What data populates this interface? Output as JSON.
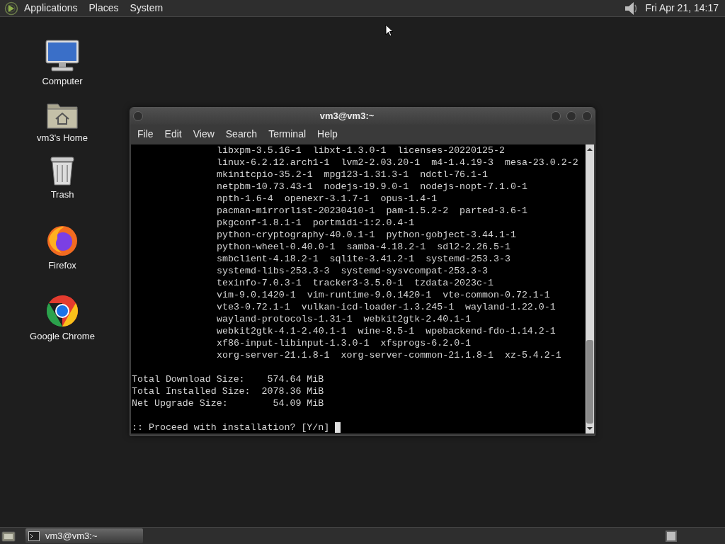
{
  "top_panel": {
    "menus": [
      "Applications",
      "Places",
      "System"
    ],
    "clock": "Fri Apr 21, 14:17"
  },
  "desktop_icons": [
    {
      "label": "Computer",
      "kind": "computer"
    },
    {
      "label": "vm3's Home",
      "kind": "home"
    },
    {
      "label": "Trash",
      "kind": "trash"
    },
    {
      "label": "Firefox",
      "kind": "firefox"
    },
    {
      "label": "Google Chrome",
      "kind": "chrome"
    }
  ],
  "window": {
    "title": "vm3@vm3:~",
    "menus": [
      "File",
      "Edit",
      "View",
      "Search",
      "Terminal",
      "Help"
    ],
    "package_lines": [
      "libxpm-3.5.16-1  libxt-1.3.0-1  licenses-20220125-2",
      "linux-6.2.12.arch1-1  lvm2-2.03.20-1  m4-1.4.19-3  mesa-23.0.2-2",
      "mkinitcpio-35.2-1  mpg123-1.31.3-1  ndctl-76.1-1",
      "netpbm-10.73.43-1  nodejs-19.9.0-1  nodejs-nopt-7.1.0-1",
      "npth-1.6-4  openexr-3.1.7-1  opus-1.4-1",
      "pacman-mirrorlist-20230410-1  pam-1.5.2-2  parted-3.6-1",
      "pkgconf-1.8.1-1  portmidi-1:2.0.4-1",
      "python-cryptography-40.0.1-1  python-gobject-3.44.1-1",
      "python-wheel-0.40.0-1  samba-4.18.2-1  sdl2-2.26.5-1",
      "smbclient-4.18.2-1  sqlite-3.41.2-1  systemd-253.3-3",
      "systemd-libs-253.3-3  systemd-sysvcompat-253.3-3",
      "texinfo-7.0.3-1  tracker3-3.5.0-1  tzdata-2023c-1",
      "vim-9.0.1420-1  vim-runtime-9.0.1420-1  vte-common-0.72.1-1",
      "vte3-0.72.1-1  vulkan-icd-loader-1.3.245-1  wayland-1.22.0-1",
      "wayland-protocols-1.31-1  webkit2gtk-2.40.1-1",
      "webkit2gtk-4.1-2.40.1-1  wine-8.5-1  wpebackend-fdo-1.14.2-1",
      "xf86-input-libinput-1.3.0-1  xfsprogs-6.2.0-1",
      "xorg-server-21.1.8-1  xorg-server-common-21.1.8-1  xz-5.4.2-1"
    ],
    "summary_lines": [
      "Total Download Size:    574.64 MiB",
      "Total Installed Size:  2078.36 MiB",
      "Net Upgrade Size:        54.09 MiB"
    ],
    "prompt": ":: Proceed with installation? [Y/n] "
  },
  "taskbar": {
    "tasks": [
      {
        "label": "vm3@vm3:~",
        "selected": true
      }
    ]
  }
}
